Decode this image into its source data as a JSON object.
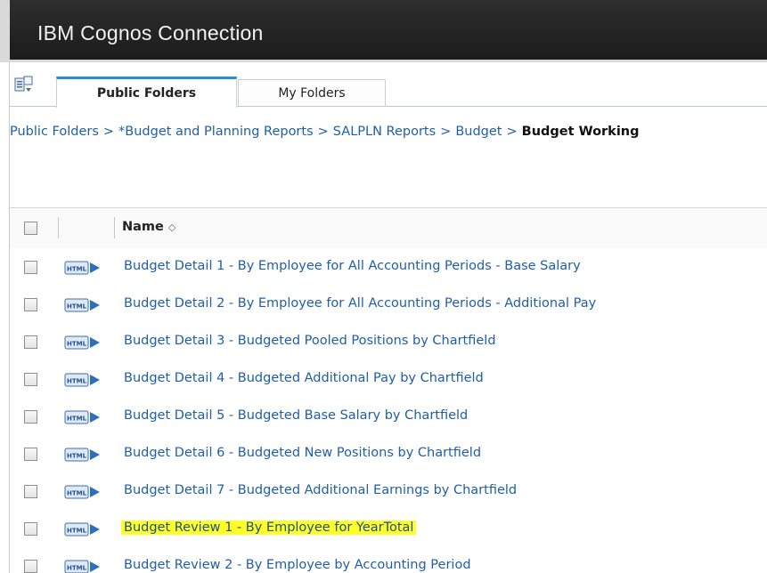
{
  "app": {
    "title": "IBM Cognos Connection"
  },
  "tabs": [
    {
      "label": "Public Folders",
      "active": true
    },
    {
      "label": "My Folders",
      "active": false
    }
  ],
  "breadcrumb": {
    "items": [
      "Public Folders",
      "*Budget and Planning Reports",
      "SALPLN Reports",
      "Budget"
    ],
    "current": "Budget Working",
    "separator": ">"
  },
  "list": {
    "columns": {
      "name": "Name"
    },
    "rows": [
      {
        "label": "Budget Detail 1 - By Employee for All Accounting Periods - Base Salary",
        "icon": "html-report-icon",
        "highlighted": false
      },
      {
        "label": "Budget Detail 2 - By Employee for All Accounting Periods - Additional Pay",
        "icon": "html-report-icon",
        "highlighted": false
      },
      {
        "label": "Budget Detail 3 - Budgeted Pooled Positions by Chartfield",
        "icon": "html-report-icon",
        "highlighted": false
      },
      {
        "label": "Budget Detail 4 - Budgeted Additional Pay by Chartfield",
        "icon": "html-report-icon",
        "highlighted": false
      },
      {
        "label": "Budget Detail 5 - Budgeted Base Salary by Chartfield",
        "icon": "html-report-icon",
        "highlighted": false
      },
      {
        "label": "Budget Detail 6 - Budgeted New Positions by Chartfield",
        "icon": "html-report-icon",
        "highlighted": false
      },
      {
        "label": "Budget Detail 7 - Budgeted Additional Earnings by Chartfield",
        "icon": "html-report-icon",
        "highlighted": false
      },
      {
        "label": "Budget Review 1 - By Employee for YearTotal",
        "icon": "html-report-icon",
        "highlighted": true
      },
      {
        "label": "Budget Review 2 - By Employee by Accounting Period",
        "icon": "html-report-icon",
        "highlighted": false
      }
    ]
  },
  "colors": {
    "header_bg": "#222222",
    "link": "#1f5ea8",
    "active_tab_accent": "#2a8dd4",
    "highlight": "#ffff28"
  }
}
